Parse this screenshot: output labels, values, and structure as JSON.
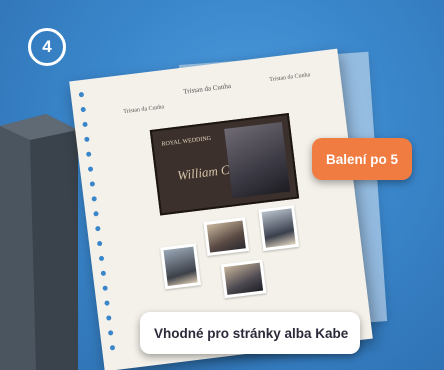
{
  "badge": {
    "step": "4"
  },
  "labels": {
    "pack": "Balení po 5",
    "compat": "Vhodné pro stránky alba Kabe"
  },
  "page": {
    "header_center": "Tristan da Cunha",
    "header_left": "Tristan da Cunha",
    "header_right": "Tristan da Cunha",
    "sheet_title": "ROYAL WEDDING",
    "sheet_names": "William Catherine"
  },
  "colors": {
    "background": "#3a86cb",
    "accent_label": "#f07c41",
    "label_bg": "#ffffff",
    "page": "#f4f1ea"
  }
}
